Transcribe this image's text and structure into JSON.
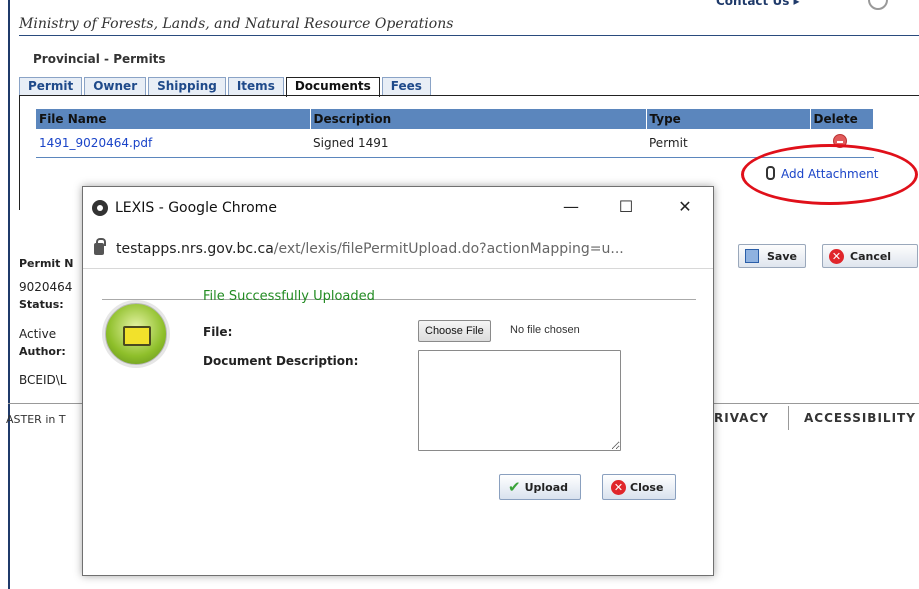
{
  "header": {
    "ministry": "Ministry of Forests, Lands, and Natural Resource Operations",
    "contact": "Contact Us ▸"
  },
  "page": {
    "section_title": "Provincial - Permits",
    "tabs": [
      "Permit",
      "Owner",
      "Shipping",
      "Items",
      "Documents",
      "Fees"
    ],
    "active_tab": "Documents"
  },
  "documents": {
    "columns": [
      "File Name",
      "Description",
      "Type",
      "Delete"
    ],
    "rows": [
      {
        "file_name": "1491_9020464.pdf",
        "description": "Signed 1491",
        "type": "Permit"
      }
    ],
    "add_attachment": "Add Attachment"
  },
  "details": {
    "permit_label": "Permit N",
    "permit_value": "9020464",
    "status_label": "Status:",
    "status_value": "Active",
    "author_label": "Author:",
    "author_value": "BCEID\\L"
  },
  "actions": {
    "save": "Save",
    "cancel": "Cancel"
  },
  "footer": {
    "left": "ASTER in T",
    "privacy": "RIVACY",
    "accessibility": "ACCESSIBILITY"
  },
  "popup": {
    "title": "LEXIS - Google Chrome",
    "url_host": "testapps.nrs.gov.bc.ca",
    "url_path": "/ext/lexis/filePermitUpload.do?actionMapping=u...",
    "success_message": "File Successfully Uploaded",
    "file_label": "File:",
    "choose_file": "Choose File",
    "no_file": "No file chosen",
    "description_label": "Document Description:",
    "upload": "Upload",
    "close": "Close"
  },
  "colors": {
    "header_blue": "#5b86bd",
    "link": "#1a44c8",
    "success": "#228b22",
    "highlight": "#e0101a"
  }
}
